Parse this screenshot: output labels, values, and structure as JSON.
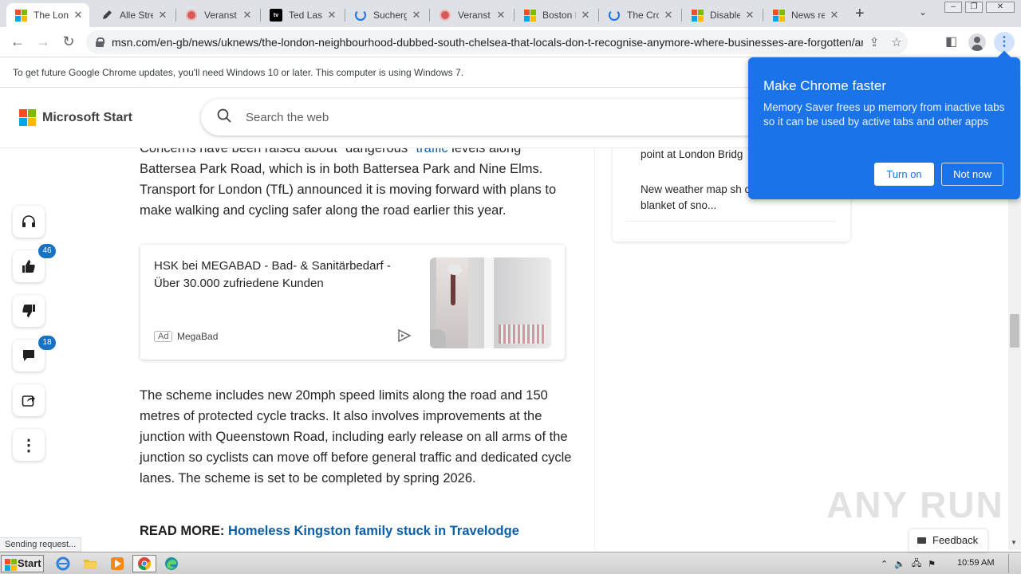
{
  "browser": {
    "tabs": [
      {
        "label": "The Lond",
        "icon": "microsoft-icon",
        "active": true
      },
      {
        "label": "Alle Stre",
        "icon": "pen-icon",
        "active": false
      },
      {
        "label": "Veranst",
        "icon": "red-circle-icon",
        "active": false
      },
      {
        "label": "Ted Lass",
        "icon": "appletv-icon",
        "active": false
      },
      {
        "label": "Sucherg",
        "icon": "loading-spinner-icon",
        "active": false
      },
      {
        "label": "Veranst",
        "icon": "red-circle-icon",
        "active": false
      },
      {
        "label": "Boston M",
        "icon": "microsoft-icon",
        "active": false
      },
      {
        "label": "The Cro",
        "icon": "loading-spinner-icon",
        "active": false
      },
      {
        "label": "Disabled",
        "icon": "microsoft-icon",
        "active": false
      },
      {
        "label": "News rep",
        "icon": "microsoft-icon",
        "active": false
      }
    ],
    "url": "msn.com/en-gb/news/uknews/the-london-neighbourhood-dubbed-south-chelsea-that-locals-don-t-recognise-anymore-where-businesses-are-forgotten/ar-...",
    "info_bar": "To get future Google Chrome updates, you'll need Windows 10 or later. This computer is using Windows 7.",
    "status_text": "Sending request..."
  },
  "msn": {
    "brand": "Microsoft Start",
    "search_placeholder": "Search the web",
    "rail": {
      "like_count": "46",
      "comment_count": "18"
    }
  },
  "article": {
    "para1_pre": "Concerns have been raised about \"dangerous\" ",
    "para1_link": "traffic",
    "para1_post": " levels along Battersea Park Road, which is in both Battersea Park and Nine Elms. Transport for London (TfL) announced it is moving forward with plans to make walking and cycling safer along the road earlier this year.",
    "para2": "The scheme includes new 20mph speed limits along the road and 150 metres of protected cycle tracks. It also involves improvements at the junction with Queenstown Road, including early release on all arms of the junction so cyclists can move off before general traffic and dedicated cycle lanes. The scheme is set to be completed by spring 2026.",
    "read_more_label": "READ MORE:",
    "read_more_link": "Homeless Kingston family stuck in Travelodge"
  },
  "ad": {
    "title": "HSK bei MEGABAD - Bad- & Sanitärbedarf - Über 30.000 zufriedene Kunden",
    "tag": "Ad",
    "brand": "MegaBad"
  },
  "sidebar": {
    "stories": [
      "point at London Bridg",
      "New weather map sh covered in a thin blanket of sno..."
    ]
  },
  "popup": {
    "title": "Make Chrome faster",
    "body": "Memory Saver frees up memory from inactive tabs so it can be used by active tabs and other apps",
    "turn_on": "Turn on",
    "not_now": "Not now"
  },
  "feedback_label": "Feedback",
  "watermark": "ANY RUN",
  "taskbar": {
    "start_label": "Start",
    "clock": "10:59 AM"
  },
  "colors": {
    "chrome_blue": "#1a73e8",
    "link_blue": "#0a5fa8",
    "badge_blue": "#1971c2"
  }
}
